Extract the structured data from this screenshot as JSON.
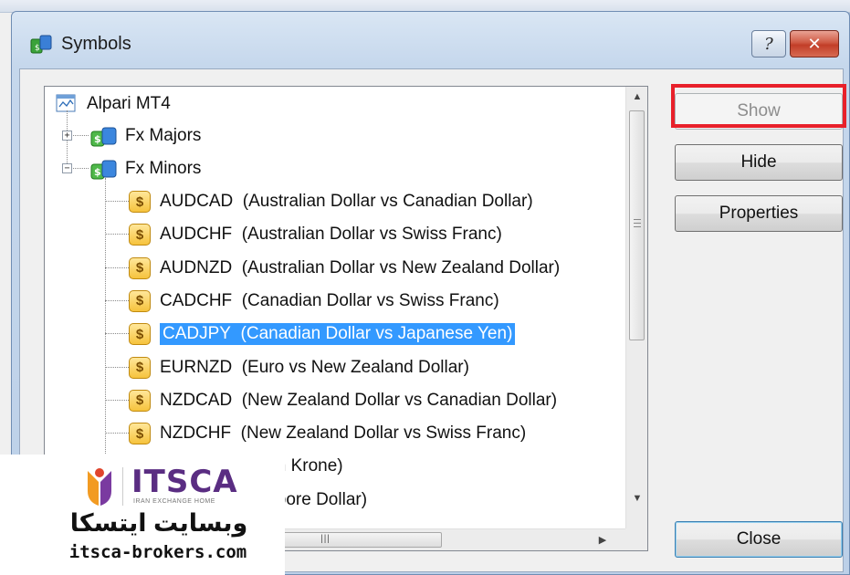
{
  "window": {
    "title": "Symbols",
    "help_label": "?",
    "close_label": "✕"
  },
  "tree": {
    "root": {
      "label": "Alpari MT4",
      "icon": "terminal-icon"
    },
    "groups": [
      {
        "label": "Fx Majors",
        "expanded": false,
        "expander": "+",
        "icon": "folder-symbols-icon"
      },
      {
        "label": "Fx Minors",
        "expanded": true,
        "expander": "−",
        "icon": "folder-symbols-icon"
      }
    ],
    "symbols": [
      {
        "code": "AUDCAD",
        "desc": "(Australian Dollar vs Canadian Dollar)",
        "selected": false
      },
      {
        "code": "AUDCHF",
        "desc": "(Australian Dollar vs Swiss Franc)",
        "selected": false
      },
      {
        "code": "AUDNZD",
        "desc": "(Australian Dollar vs New Zealand Dollar)",
        "selected": false
      },
      {
        "code": "CADCHF",
        "desc": "(Canadian Dollar vs Swiss Franc)",
        "selected": false
      },
      {
        "code": "CADJPY",
        "desc": "(Canadian Dollar vs Japanese Yen)",
        "selected": true
      },
      {
        "code": "EURNZD",
        "desc": "(Euro vs New Zealand Dollar)",
        "selected": false
      },
      {
        "code": "NZDCAD",
        "desc": "(New Zealand Dollar vs Canadian Dollar)",
        "selected": false
      },
      {
        "code": "NZDCHF",
        "desc": "(New Zealand Dollar vs Swiss Franc)",
        "selected": false
      },
      {
        "code": "",
        "desc": "Dollar vs Danish Krone)",
        "selected": false
      },
      {
        "code": "",
        "desc": "Dollar vs Singapore Dollar)",
        "selected": false
      }
    ],
    "coin_glyph": "$"
  },
  "buttons": {
    "show": "Show",
    "hide": "Hide",
    "properties": "Properties",
    "close": "Close"
  },
  "watermark": {
    "brand": "ITSCA",
    "tagline": "IRAN EXCHANGE HOME",
    "arabic": "وبسایت ایتسکا",
    "url": "itsca-brokers.com"
  },
  "colors": {
    "selection": "#3399ff",
    "highlight_box": "#e8202a",
    "brand": "#5a2d82"
  }
}
